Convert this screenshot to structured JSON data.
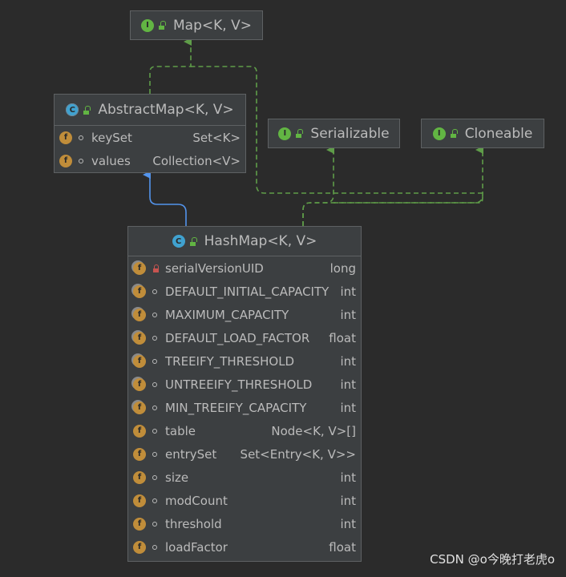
{
  "diagram": {
    "nodes": {
      "map": {
        "kind": "interface",
        "badge": "I",
        "title": "Map<K, V>",
        "fields": []
      },
      "abstract_map": {
        "kind": "abstract-class",
        "badge": "C",
        "title": "AbstractMap<K, V>",
        "fields": [
          {
            "name": "keySet",
            "type": "Set<K>",
            "badge": "f",
            "visibility": "package"
          },
          {
            "name": "values",
            "type": "Collection<V>",
            "badge": "f",
            "visibility": "package"
          }
        ]
      },
      "serializable": {
        "kind": "interface",
        "badge": "I",
        "title": "Serializable",
        "fields": []
      },
      "cloneable": {
        "kind": "interface",
        "badge": "I",
        "title": "Cloneable",
        "fields": []
      },
      "hash_map": {
        "kind": "class",
        "badge": "C",
        "title": "HashMap<K, V>",
        "fields": [
          {
            "name": "serialVersionUID",
            "type": "long",
            "badge": "f",
            "static": true,
            "visibility": "private"
          },
          {
            "name": "DEFAULT_INITIAL_CAPACITY",
            "type": "int",
            "badge": "f",
            "static": true,
            "visibility": "package"
          },
          {
            "name": "MAXIMUM_CAPACITY",
            "type": "int",
            "badge": "f",
            "static": true,
            "visibility": "package"
          },
          {
            "name": "DEFAULT_LOAD_FACTOR",
            "type": "float",
            "badge": "f",
            "static": true,
            "visibility": "package"
          },
          {
            "name": "TREEIFY_THRESHOLD",
            "type": "int",
            "badge": "f",
            "static": true,
            "visibility": "package"
          },
          {
            "name": "UNTREEIFY_THRESHOLD",
            "type": "int",
            "badge": "f",
            "static": true,
            "visibility": "package"
          },
          {
            "name": "MIN_TREEIFY_CAPACITY",
            "type": "int",
            "badge": "f",
            "static": true,
            "visibility": "package"
          },
          {
            "name": "table",
            "type": "Node<K, V>[]",
            "badge": "f",
            "static": false,
            "visibility": "package"
          },
          {
            "name": "entrySet",
            "type": "Set<Entry<K, V>>",
            "badge": "f",
            "static": false,
            "visibility": "package"
          },
          {
            "name": "size",
            "type": "int",
            "badge": "f",
            "static": false,
            "visibility": "package"
          },
          {
            "name": "modCount",
            "type": "int",
            "badge": "f",
            "static": false,
            "visibility": "package"
          },
          {
            "name": "threshold",
            "type": "int",
            "badge": "f",
            "static": false,
            "visibility": "package"
          },
          {
            "name": "loadFactor",
            "type": "float",
            "badge": "f",
            "static": false,
            "visibility": "package"
          }
        ]
      }
    },
    "edges": [
      {
        "from": "abstract_map",
        "to": "map",
        "type": "implements"
      },
      {
        "from": "hash_map",
        "to": "abstract_map",
        "type": "extends"
      },
      {
        "from": "hash_map",
        "to": "map",
        "type": "implements"
      },
      {
        "from": "hash_map",
        "to": "serializable",
        "type": "implements"
      },
      {
        "from": "hash_map",
        "to": "cloneable",
        "type": "implements"
      }
    ],
    "colors": {
      "background": "#2b2b2b",
      "box": "#3c3f41",
      "border": "#5e6163",
      "text": "#bbbbbb",
      "implements_edge": "#5f9d49",
      "extends_edge": "#5394ec",
      "interface_badge": "#62b543",
      "class_badge": "#40a2d0",
      "field_badge": "#c08d3a"
    }
  },
  "watermark": "CSDN @o今晚打老虎o"
}
